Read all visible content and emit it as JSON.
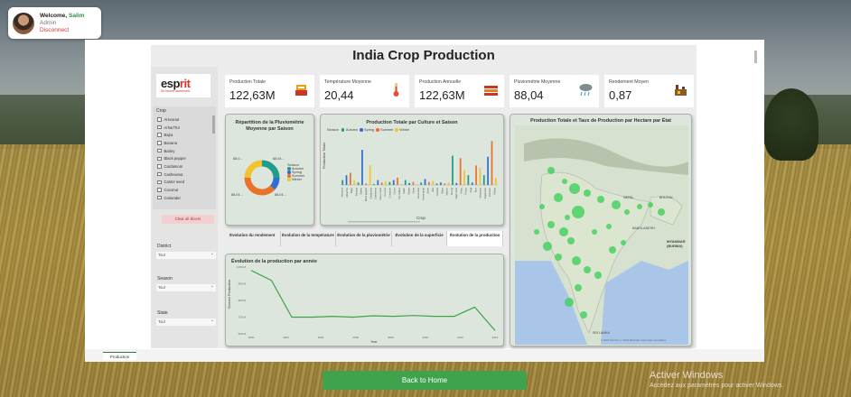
{
  "profile": {
    "welcome": "Welcome,",
    "name": "Salim",
    "role": "Admin",
    "disconnect": "Disconnect"
  },
  "dashboard": {
    "title": "India Crop Production",
    "logo": {
      "text_main": "esp",
      "text_accent": "rit",
      "tagline": "Se former autrement"
    },
    "kpis": [
      {
        "label": "Production Totale",
        "value": "122,63M",
        "icon": "crop-icon"
      },
      {
        "label": "Température Moyenne",
        "value": "20,44",
        "icon": "thermometer-icon"
      },
      {
        "label": "Production Annuelle",
        "value": "122,63M",
        "icon": "harvest-icon"
      },
      {
        "label": "Pluviométrie Moyenne",
        "value": "88,04",
        "icon": "rain-cloud-icon"
      },
      {
        "label": "Rendement Moyen",
        "value": "0,87",
        "icon": "factory-icon"
      }
    ],
    "slicers": {
      "crop_title": "Crop",
      "crops": [
        "Arecanut",
        "Arhar/Tur",
        "Bajra",
        "Banana",
        "Barley",
        "Black pepper",
        "Cardamom",
        "Cashewnut",
        "Castor seed",
        "Coconut",
        "Coriander"
      ],
      "clear_label": "Clear all slicers",
      "district_label": "District",
      "district_value": "Tout",
      "season_label": "Season",
      "season_value": "Tout",
      "state_label": "State",
      "state_value": "Tout"
    },
    "donut": {
      "title": "Répartition de la Pluviométrie Moyenne par Saison",
      "legend_title": "Season",
      "labels_left": [
        "88,0...",
        "88,04..."
      ],
      "labels_right": [
        "88,04...",
        "88,04..."
      ]
    },
    "bar_chart": {
      "title": "Production Totale par Culture et Saison",
      "legend_title": "Season",
      "ylabel": "Production Totale",
      "xlabel": "Crop",
      "crop_ticks": [
        "Arecanut",
        "Arhar/Tur",
        "Bajra",
        "Banana",
        "Barley",
        "Black pepper",
        "Cardamom",
        "Cashewnut",
        "Castor seed",
        "Coconut",
        "Coriander",
        "Cotton",
        "Dry chillies",
        "Garlic",
        "Ginger",
        "Gram",
        "Groundnut",
        "Horse-gram",
        "Jowar",
        "Jute",
        "Linseed",
        "Maize",
        "Masoor",
        "Moong",
        "Niger seed",
        "Onion",
        "Potato",
        "Ragi",
        "Rice",
        "Sesamum",
        "Sugarcane",
        "Turmeric",
        "Wheat"
      ]
    },
    "tabs": [
      "Évolution du rendement",
      "Évolution de la température",
      "Évolution de la pluviométrie",
      "Évolution de la superficie",
      "Évolution de la production"
    ],
    "active_tab": 4,
    "line_chart": {
      "title": "Évolution de la production par année",
      "ylabel": "Somme Production",
      "xlabel": "Year",
      "y_ticks": [
        "1000 M",
        "900 M",
        "800 M",
        "700 M",
        "600 M"
      ],
      "x_ticks": [
        "2000",
        "2002",
        "2004",
        "2006",
        "2008",
        "2010",
        "2012",
        "2014"
      ]
    },
    "map": {
      "title": "Production Totale et Taux de Production par Hectare par État",
      "labels": [
        "NEPAL",
        "BHUTAN",
        "BANGLADESH",
        "MYANMAR (BURMA)",
        "SRI LANKA"
      ],
      "attribution": "© 2024 TomTom, © 2024 Microsoft Corporation  Conditions"
    },
    "page_tab": "Production"
  },
  "back_button": "Back to Home",
  "watermark": {
    "line1": "Activer Windows",
    "line2": "Accédez aux paramètres pour activer Windows."
  },
  "colors": {
    "accent_green": "#3fa34d",
    "autumn": "#1f9c8a",
    "spring": "#2f6fd1",
    "summer": "#e8742a",
    "winter": "#f2c230",
    "map_bubble": "#3fcf5b"
  },
  "chart_data": [
    {
      "type": "pie",
      "title": "Répartition de la Pluviométrie Moyenne par Saison",
      "categories": [
        "Autumn",
        "Spring",
        "Summer",
        "Winter"
      ],
      "values": [
        25,
        12,
        38,
        25
      ]
    },
    {
      "type": "bar",
      "title": "Production Totale par Culture et Saison",
      "xlabel": "Crop",
      "ylabel": "Production Totale",
      "categories": [
        "Autumn",
        "Spring",
        "Summer",
        "Winter"
      ],
      "values": [
        0.1,
        0.2,
        0.25,
        0.1,
        0.05,
        0.72,
        0.03,
        0.4,
        0.02,
        0.1,
        0.05,
        0.08,
        0.06,
        0.1,
        0.15,
        0.02,
        0.1,
        0.04,
        0.06,
        0.02,
        0.05,
        0.12,
        0.06,
        0.08,
        0.03,
        0.05,
        0.03,
        0.05,
        0.6,
        0.04,
        0.55,
        0.3,
        0.2,
        0.05,
        0.4,
        0.35,
        0.2,
        0.58,
        0.9,
        0.15
      ]
    },
    {
      "type": "line",
      "title": "Évolution de la production par année",
      "xlabel": "Year",
      "ylabel": "Somme Production",
      "x": [
        1997,
        1998,
        2000,
        2002,
        2004,
        2006,
        2008,
        2010,
        2012,
        2013,
        2014,
        2015
      ],
      "y": [
        980,
        920,
        700,
        700,
        705,
        700,
        708,
        705,
        710,
        705,
        705,
        760,
        620
      ],
      "ylim": [
        600,
        1000
      ]
    }
  ]
}
